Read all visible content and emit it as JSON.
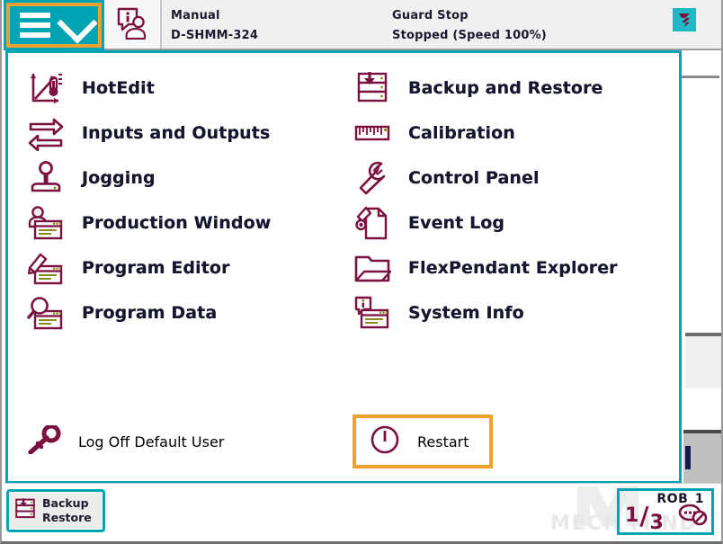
{
  "app": {
    "title": "ABB FlexPendant Main Menu"
  },
  "status_bar": {
    "menu_button_icon": "hamburger-chevron-icon",
    "info_icon": "operator-info-icon",
    "operating_mode": "Manual",
    "controller_name": "D-SHMM-324",
    "controller_state": "Guard Stop",
    "execution_state": "Stopped (Speed 100%)",
    "state_icon": "stopped-program-icon"
  },
  "menu": {
    "left_items": [
      {
        "label": "HotEdit",
        "icon": "hotedit-icon"
      },
      {
        "label": "Inputs and Outputs",
        "icon": "inputs-outputs-icon"
      },
      {
        "label": "Jogging",
        "icon": "jogging-joystick-icon"
      },
      {
        "label": "Production Window",
        "icon": "production-window-icon"
      },
      {
        "label": "Program Editor",
        "icon": "program-editor-icon"
      },
      {
        "label": "Program Data",
        "icon": "program-data-icon"
      }
    ],
    "right_items": [
      {
        "label": "Backup and Restore",
        "icon": "backup-restore-icon"
      },
      {
        "label": "Calibration",
        "icon": "calibration-ruler-icon"
      },
      {
        "label": "Control Panel",
        "icon": "control-panel-wrench-icon"
      },
      {
        "label": "Event Log",
        "icon": "event-log-icon"
      },
      {
        "label": "FlexPendant Explorer",
        "icon": "folder-icon"
      },
      {
        "label": "System Info",
        "icon": "system-info-icon"
      }
    ],
    "log_off": {
      "label": "Log Off Default User",
      "icon": "key-icon"
    },
    "restart": {
      "label": "Restart",
      "icon": "power-restart-icon"
    }
  },
  "taskbar": {
    "task_button": {
      "line1": "Backup",
      "line2": "Restore",
      "icon": "backup-restore-icon"
    },
    "robot": {
      "name": "ROB_1",
      "numerator": "1",
      "separator": "/",
      "denominator": "3",
      "icon": "quickset-menu-icon"
    }
  },
  "watermark": {
    "text": "MECH MIND"
  },
  "colors": {
    "accent_teal": "#00a4b4",
    "highlight_orange": "#f0a030",
    "icon_maroon": "#7a1140",
    "text_dark": "#161630",
    "icon_olive": "#8a8a20"
  }
}
